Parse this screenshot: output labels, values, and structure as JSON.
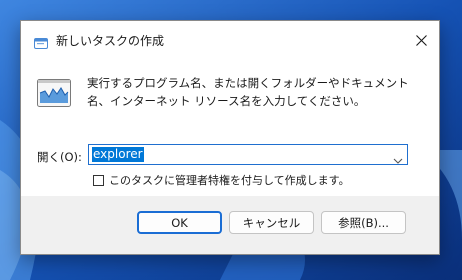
{
  "dialog": {
    "title": "新しいタスクの作成",
    "close_icon": "close-icon",
    "app_icon": "run-app-icon"
  },
  "content": {
    "description": "実行するプログラム名、または開くフォルダーやドキュメント名、インターネット リソース名を入力してください。",
    "open_label": "開く(O):",
    "open_value": "explorer",
    "checkbox_label": "このタスクに管理者特権を付与して作成します。",
    "checkbox_checked": false
  },
  "buttons": {
    "ok": "OK",
    "cancel": "キャンセル",
    "browse": "参照(B)..."
  },
  "colors": {
    "wallpaper": "#1a56b8",
    "accent": "#0078d7"
  }
}
